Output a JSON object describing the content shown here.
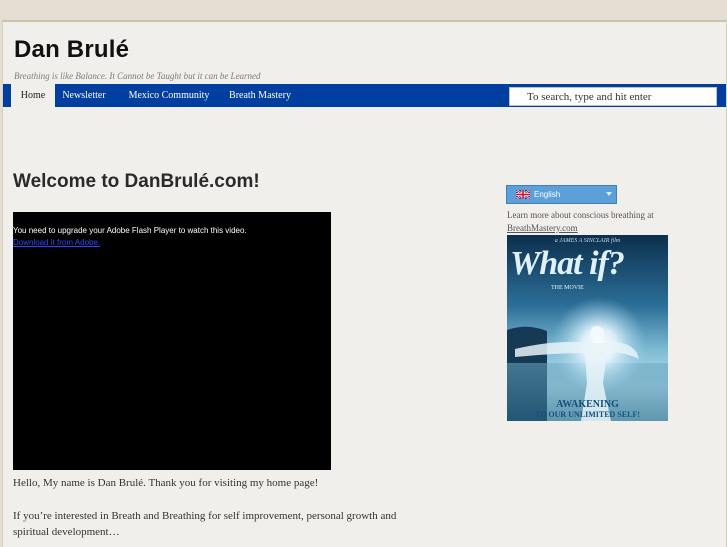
{
  "site": {
    "title": "Dan Brulé",
    "tagline": "Breathing is like Balance. It Cannot be Taught but it can be Learned"
  },
  "nav": {
    "items": [
      {
        "label": "Home",
        "active": true
      },
      {
        "label": "Newsletter",
        "active": false
      },
      {
        "label": "Mexico Community",
        "active": false
      },
      {
        "label": "Breath Mastery",
        "active": false
      }
    ],
    "search_placeholder": "To search, type and hit enter"
  },
  "main": {
    "heading": "Welcome to DanBrulé.com!",
    "video": {
      "message": "You need to upgrade your Adobe Flash Player to watch this video.",
      "link_text": "Download it from Adobe."
    },
    "paragraphs": [
      "Hello, My name is Dan Brulé. Thank you for visiting my home page!",
      "If you’re interested in Breath and Breathing for self improvement, personal growth and spiritual development…"
    ]
  },
  "sidebar": {
    "language": {
      "selected": "English",
      "flag": "uk-flag-icon"
    },
    "breathing_text": "Learn more about conscious breathing at",
    "breathing_link": "BreathMastery.com",
    "poster": {
      "credit": "a JAMES A SINCLAIR film",
      "title": "What if?",
      "subtitle": "THE MOVIE",
      "tagline_1": "AWAKENING",
      "tagline_2": "TO OUR UNLIMITED SELF!"
    }
  },
  "colors": {
    "nav_background": "#003fa0",
    "page_background": "#f1efec",
    "outer_background": "#e3ded1",
    "language_select": "#5d9fd8"
  }
}
